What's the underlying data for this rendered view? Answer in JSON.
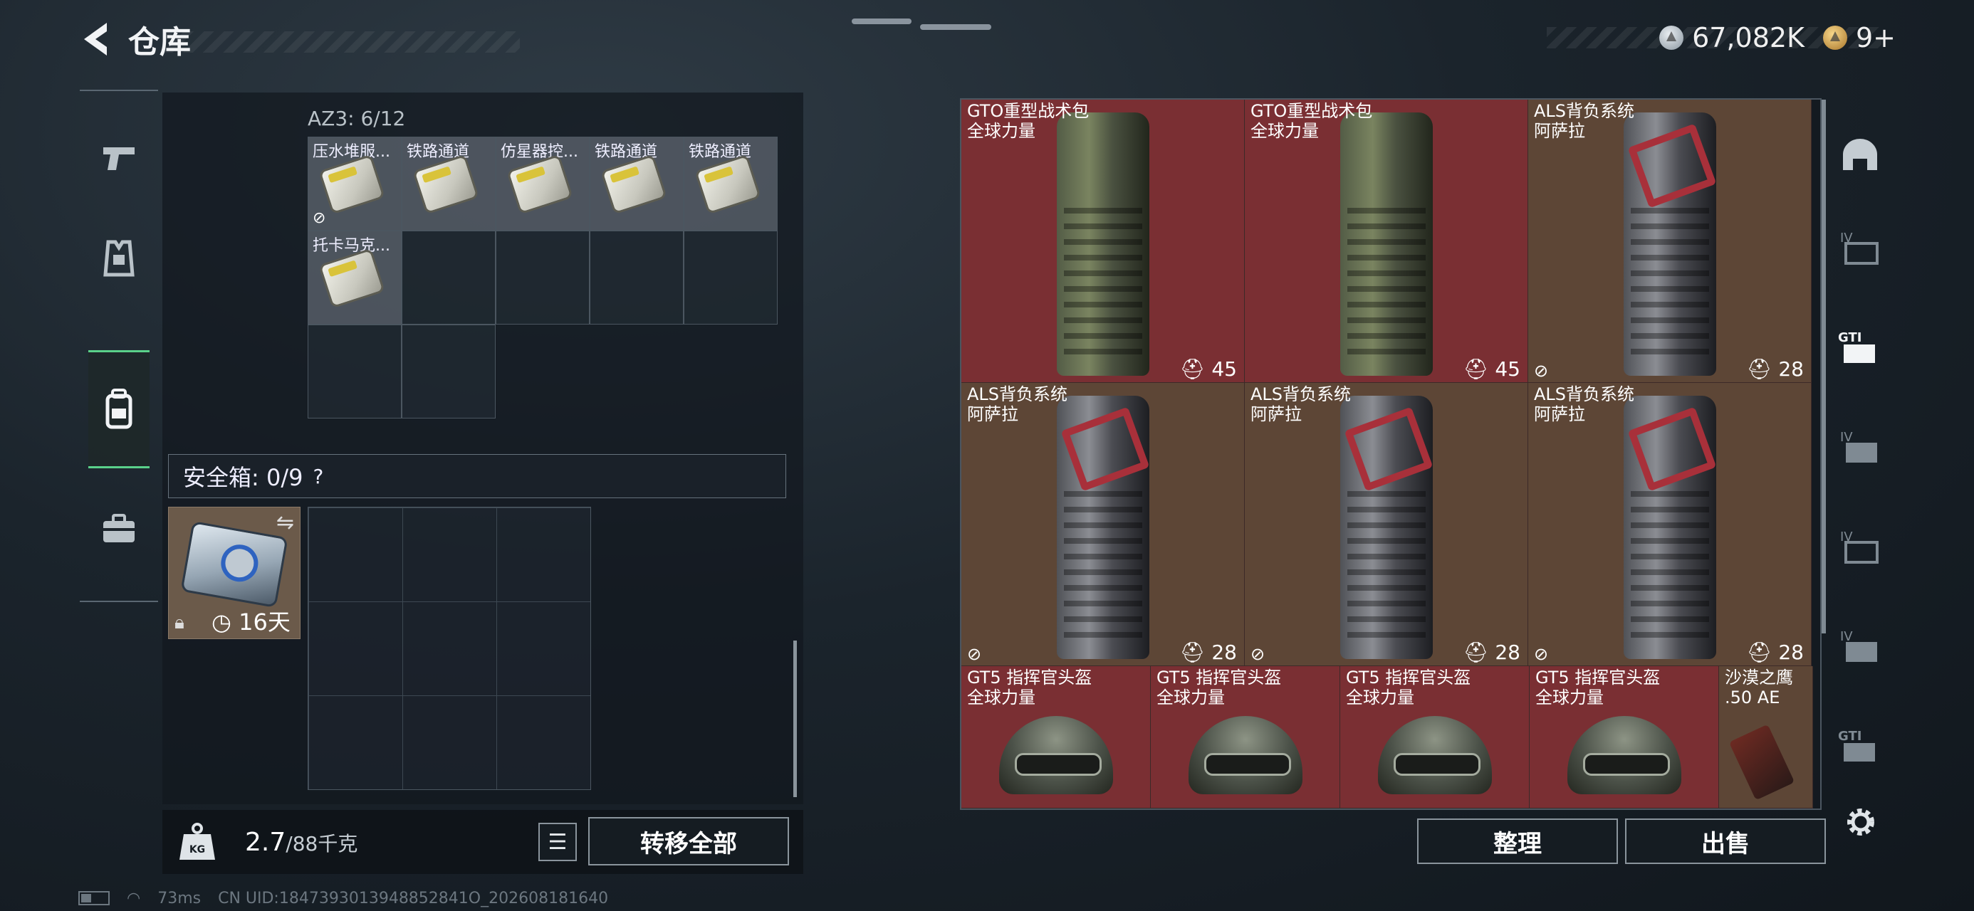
{
  "header": {
    "title": "仓库",
    "currency_silver": "67,082K",
    "currency_gold": "9+"
  },
  "left_nav": [
    "weapon-icon",
    "armor-icon",
    "backpack-icon",
    "toolbox-icon"
  ],
  "storage": {
    "label": "AZ3: 6/12",
    "items": [
      {
        "name": "压水堆服...",
        "no_sell": true
      },
      {
        "name": "铁路通道",
        "no_sell": false
      },
      {
        "name": "仿星器控...",
        "no_sell": false
      },
      {
        "name": "铁路通道",
        "no_sell": false
      },
      {
        "name": "铁路通道",
        "no_sell": false
      },
      {
        "name": "托卡马克...",
        "no_sell": false
      }
    ]
  },
  "safe": {
    "label": "安全箱: 0/9",
    "help": "?",
    "timer": "16天"
  },
  "footer_left": {
    "weight": "2.7",
    "weight_max": "/88千克",
    "transfer_label": "转移全部"
  },
  "inventory": [
    {
      "name": "GTO重型战术包\n全球力量",
      "count": "45",
      "no_sell": false,
      "kind": "pack-green",
      "bg": "red"
    },
    {
      "name": "GTO重型战术包\n全球力量",
      "count": "45",
      "no_sell": false,
      "kind": "pack-green",
      "bg": "red"
    },
    {
      "name": "ALS背负系统\n阿萨拉",
      "count": "28",
      "no_sell": true,
      "kind": "pack-grey",
      "bg": "brown"
    },
    {
      "name": "ALS背负系统\n阿萨拉",
      "count": "28",
      "no_sell": true,
      "kind": "pack-grey",
      "bg": "brown"
    },
    {
      "name": "ALS背负系统\n阿萨拉",
      "count": "28",
      "no_sell": true,
      "kind": "pack-grey",
      "bg": "brown"
    },
    {
      "name": "ALS背负系统\n阿萨拉",
      "count": "28",
      "no_sell": true,
      "kind": "pack-grey",
      "bg": "brown"
    },
    {
      "name": "GT5 指挥官头盔\n全球力量",
      "count": "",
      "no_sell": false,
      "kind": "helmet",
      "bg": "red"
    },
    {
      "name": "GT5 指挥官头盔\n全球力量",
      "count": "",
      "no_sell": false,
      "kind": "helmet",
      "bg": "red"
    },
    {
      "name": "GT5 指挥官头盔\n全球力量",
      "count": "",
      "no_sell": false,
      "kind": "helmet",
      "bg": "red"
    },
    {
      "name": "GT5 指挥官头盔\n全球力量",
      "count": "",
      "no_sell": false,
      "kind": "helmet",
      "bg": "red"
    },
    {
      "name": "沙漠之鹰\n.50 AE",
      "count": "",
      "no_sell": false,
      "kind": "gun",
      "bg": "brown"
    }
  ],
  "footer_right": {
    "sort_label": "整理",
    "sell_label": "出售"
  },
  "status": {
    "ping": "73ms",
    "uid": "CN UID:1847393013948852841O_202608181640"
  }
}
